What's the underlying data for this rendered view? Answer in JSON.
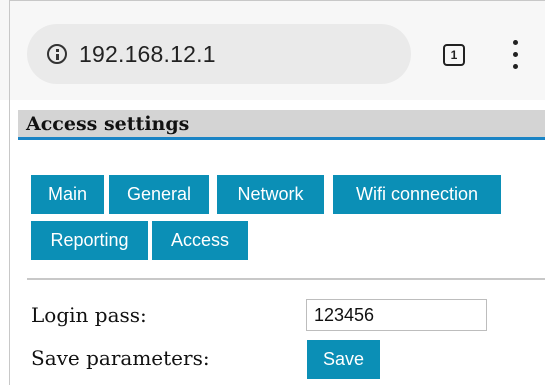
{
  "browser": {
    "url": "192.168.12.1",
    "tab_count": "1",
    "info_icon": "info-icon",
    "menu_icon": "more-vert-icon"
  },
  "page": {
    "title": "Access settings",
    "nav": [
      {
        "label": "Main"
      },
      {
        "label": "General"
      },
      {
        "label": "Network"
      },
      {
        "label": "Wifi connection"
      },
      {
        "label": "Reporting"
      },
      {
        "label": "Access"
      }
    ],
    "form": {
      "login_pass_label": "Login pass:",
      "login_pass_value": "123456",
      "save_params_label": "Save parameters:",
      "save_label": "Save"
    }
  },
  "colors": {
    "accent": "#0b8fb6",
    "header_bar": "#d4d4d4",
    "header_underline": "#1a84c5"
  }
}
